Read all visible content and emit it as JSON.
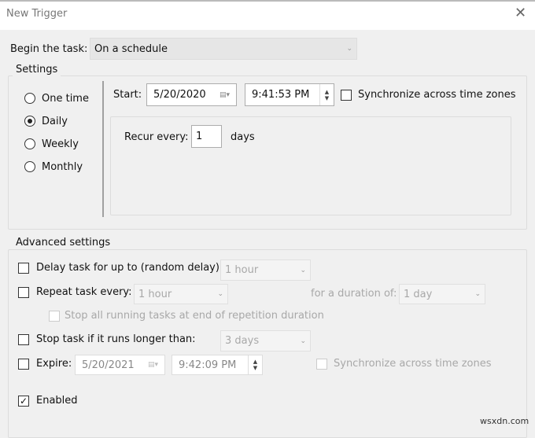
{
  "window": {
    "title": "New Trigger",
    "close_icon": "close-icon"
  },
  "begin": {
    "label": "Begin the task:",
    "value": "On a schedule"
  },
  "settings": {
    "label": "Settings",
    "options": [
      {
        "label": "One time",
        "selected": false
      },
      {
        "label": "Daily",
        "selected": true
      },
      {
        "label": "Weekly",
        "selected": false
      },
      {
        "label": "Monthly",
        "selected": false
      }
    ],
    "start_label": "Start:",
    "start_date": "5/20/2020",
    "start_time": "9:41:53 PM",
    "sync_label": "Synchronize across time zones",
    "sync_checked": false,
    "recur_label": "Recur every:",
    "recur_value": "1",
    "recur_unit": "days"
  },
  "advanced": {
    "label": "Advanced settings",
    "delay_label": "Delay task for up to (random delay):",
    "delay_value": "1 hour",
    "repeat_label": "Repeat task every:",
    "repeat_value": "1 hour",
    "duration_label": "for a duration of:",
    "duration_value": "1 day",
    "stop_all_label": "Stop all running tasks at end of repetition duration",
    "stop_label": "Stop task if it runs longer than:",
    "stop_value": "3 days",
    "expire_label": "Expire:",
    "expire_date": "5/20/2021",
    "expire_time": "9:42:09 PM",
    "expire_sync_label": "Synchronize across time zones",
    "enabled_label": "Enabled",
    "enabled_checked": true
  },
  "watermark": "wsxdn.com"
}
